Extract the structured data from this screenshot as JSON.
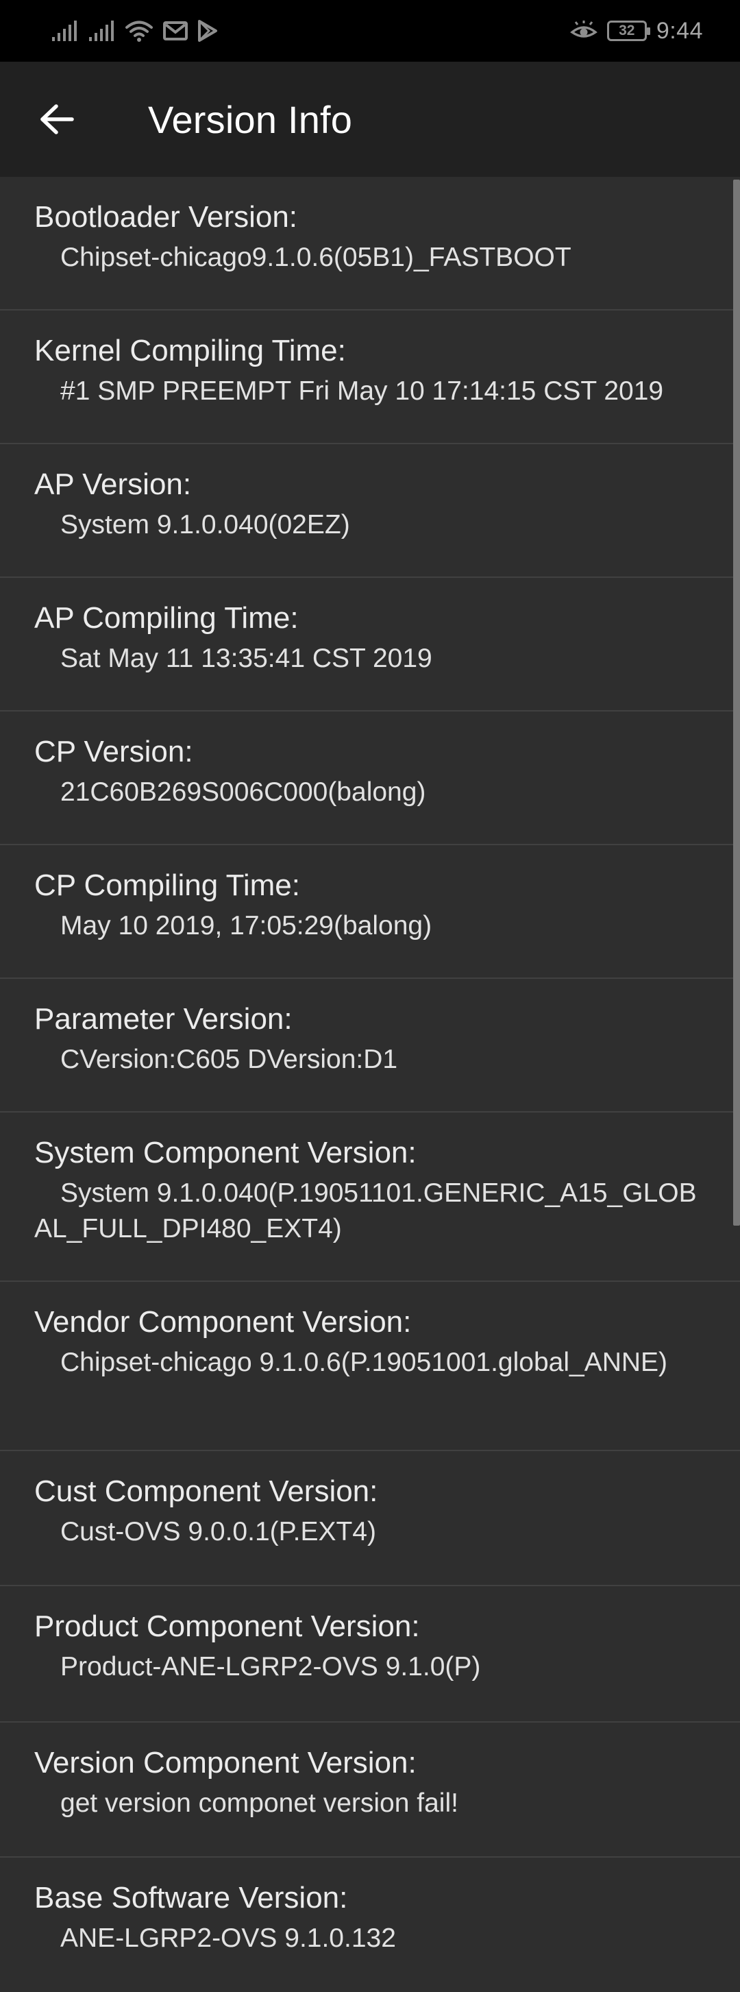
{
  "status_bar": {
    "time": "9:44",
    "battery_level": "32",
    "left_icons": [
      "signal-icon",
      "signal-icon",
      "wifi-icon",
      "gmail-icon",
      "play-store-icon"
    ],
    "right_icons": [
      "eye-comfort-icon"
    ]
  },
  "app_bar": {
    "title": "Version Info",
    "back_icon": "arrow-left-icon"
  },
  "items": [
    {
      "label": "Bootloader Version:",
      "value": "Chipset-chicago9.1.0.6(05B1)_FASTBOOT"
    },
    {
      "label": "Kernel Compiling Time:",
      "value": "#1 SMP PREEMPT Fri May 10 17:14:15 CST 2019"
    },
    {
      "label": "AP Version:",
      "value": "System 9.1.0.040(02EZ)"
    },
    {
      "label": "AP Compiling Time:",
      "value": "Sat May 11 13:35:41 CST 2019"
    },
    {
      "label": "CP Version:",
      "value": "21C60B269S006C000(balong)"
    },
    {
      "label": "CP Compiling Time:",
      "value": "May 10 2019, 17:05:29(balong)"
    },
    {
      "label": "Parameter Version:",
      "value": "CVersion:C605 DVersion:D1"
    },
    {
      "label": "System Component Version:",
      "value": "System 9.1.0.040(P.19051101.GENERIC_A15_GLOBAL_FULL_DPI480_EXT4)"
    },
    {
      "label": "Vendor Component Version:",
      "value": "Chipset-chicago 9.1.0.6(P.19051001.global_ANNE)"
    },
    {
      "label": "Cust Component Version:",
      "value": "Cust-OVS 9.0.0.1(P.EXT4)"
    },
    {
      "label": "Product Component Version:",
      "value": "Product-ANE-LGRP2-OVS 9.1.0(P)"
    },
    {
      "label": "Version Component Version:",
      "value": "get version componet version fail!"
    },
    {
      "label": "Base Software Version:",
      "value": "ANE-LGRP2-OVS 9.1.0.132"
    }
  ]
}
